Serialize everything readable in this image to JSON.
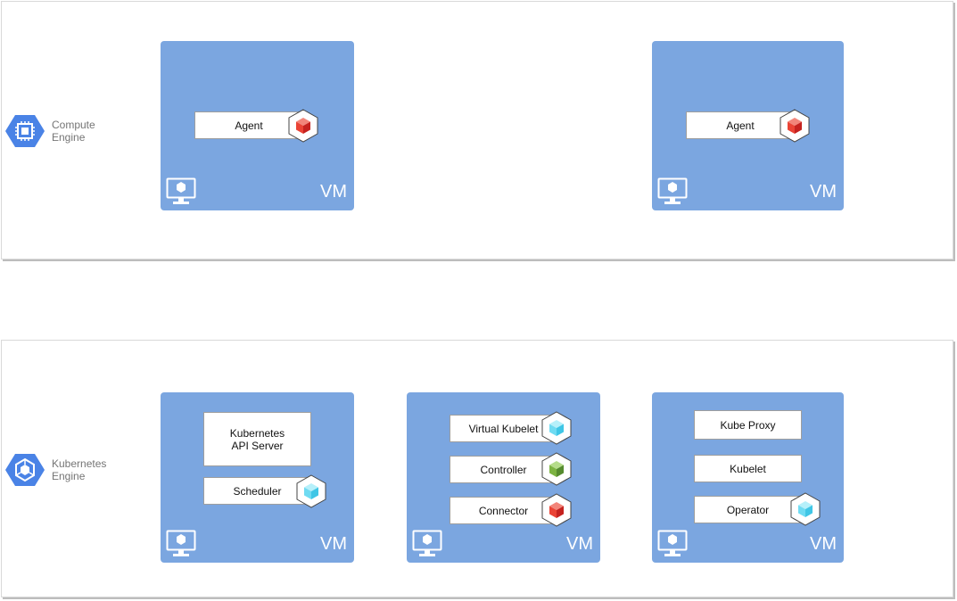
{
  "zones": [
    {
      "label_lines": [
        "Compute",
        "Engine"
      ],
      "icon": "compute-engine-icon"
    },
    {
      "label_lines": [
        "Kubernetes",
        "Engine"
      ],
      "icon": "kubernetes-engine-icon"
    }
  ],
  "vm_label": "VM",
  "nodes": {
    "ce_agent_1": "Agent",
    "ce_agent_2": "Agent",
    "k8s_api_line1": "Kubernetes",
    "k8s_api_line2": "API Server",
    "scheduler": "Scheduler",
    "virtual_kubelet": "Virtual Kubelet",
    "controller": "Controller",
    "connector": "Connector",
    "kube_proxy": "Kube Proxy",
    "kubelet": "Kubelet",
    "operator": "Operator"
  },
  "colors": {
    "vm_fill": "#7ba6e0",
    "gcp_icon_blue": "#4a83e6",
    "cube_red": "#ea4335",
    "cube_green": "#7cb342",
    "cube_cyan": "#6fdbf2"
  }
}
